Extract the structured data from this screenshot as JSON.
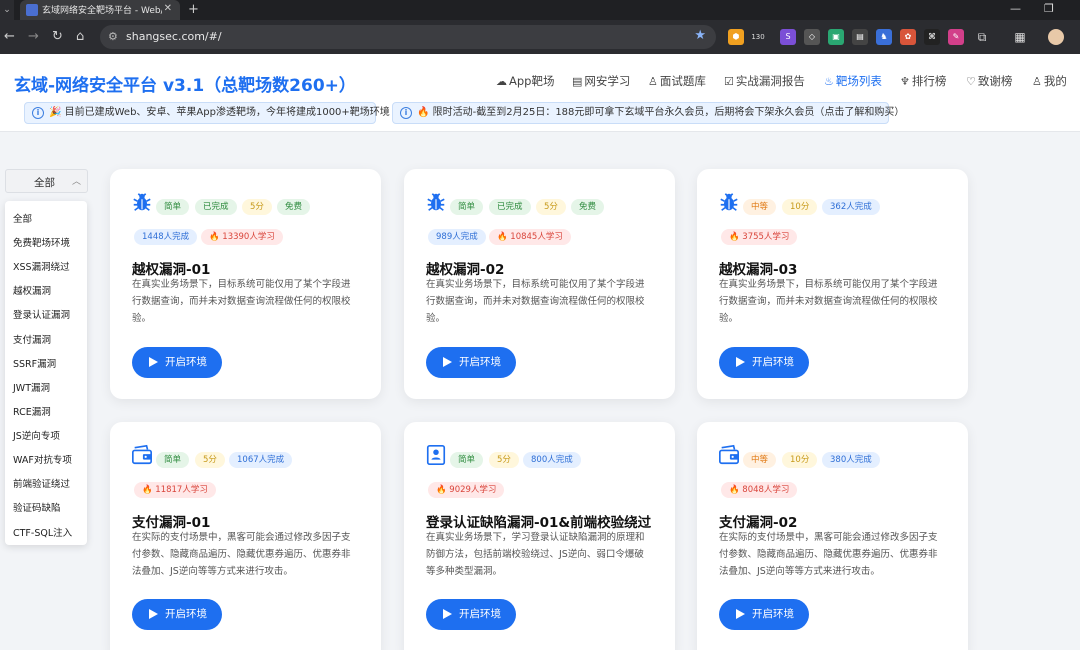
{
  "browser": {
    "tab_title": "玄域网络安全靶场平台 - Web/App",
    "url": "shangsec.com/#/",
    "ext_badge": "130"
  },
  "site": {
    "title": "玄域-网络安全平台 v3.1（总靶场数260+）",
    "nav": [
      {
        "label": "App靶场",
        "icon": "☁"
      },
      {
        "label": "网安学习",
        "icon": "▤"
      },
      {
        "label": "面试题库",
        "icon": "♙"
      },
      {
        "label": "实战漏洞报告",
        "icon": "☑"
      },
      {
        "label": "靶场列表",
        "icon": "♨"
      },
      {
        "label": "排行榜",
        "icon": "♆"
      },
      {
        "label": "致谢榜",
        "icon": "♡"
      },
      {
        "label": "我的",
        "icon": "♙"
      }
    ],
    "notice1": "🎉 目前已建成Web、安卓、苹果App渗透靶场，今年将建成1000+靶场环境",
    "notice2": "🔥 限时活动-截至到2月25日：188元即可拿下玄域平台永久会员，后期将会下架永久会员（点击了解和购买）"
  },
  "filter": {
    "selected": "全部",
    "options": [
      "全部",
      "免费靶场环境",
      "XSS漏洞绕过",
      "越权漏洞",
      "登录认证漏洞",
      "支付漏洞",
      "SSRF漏洞",
      "JWT漏洞",
      "RCE漏洞",
      "JS逆向专项",
      "WAF对抗专项",
      "前端验证绕过",
      "验证码缺陷",
      "CTF-SQL注入"
    ]
  },
  "cards": [
    {
      "title": "越权漏洞-01",
      "difficulty": "简单",
      "status": "已完成",
      "score": "5分",
      "free": "免费",
      "completed": "1448人完成",
      "learning": "13390人学习",
      "desc": "在真实业务场景下，目标系统可能仅用了某个字段进行数据查询，而并未对数据查询流程做任何的权限校验。"
    },
    {
      "title": "越权漏洞-02",
      "difficulty": "简单",
      "status": "已完成",
      "score": "5分",
      "free": "免费",
      "completed": "989人完成",
      "learning": "10845人学习",
      "desc": "在真实业务场景下，目标系统可能仅用了某个字段进行数据查询，而并未对数据查询流程做任何的权限校验。"
    },
    {
      "title": "越权漏洞-03",
      "difficulty": "中等",
      "score": "10分",
      "completed": "362人完成",
      "learning": "3755人学习",
      "desc": "在真实业务场景下，目标系统可能仅用了某个字段进行数据查询，而并未对数据查询流程做任何的权限校验。"
    },
    {
      "title": "支付漏洞-01",
      "difficulty": "简单",
      "score": "5分",
      "completed": "1067人完成",
      "learning": "11817人学习",
      "desc": "在实际的支付场景中，黑客可能会通过修改多因子支付参数、隐藏商品遍历、隐藏优惠券遍历、优惠券非法叠加、JS逆向等等方式来进行攻击。"
    },
    {
      "title": "登录认证缺陷漏洞-01&前端校验绕过",
      "difficulty": "简单",
      "score": "5分",
      "completed": "800人完成",
      "learning": "9029人学习",
      "desc": "在真实业务场景下，学习登录认证缺陷漏洞的原理和防御方法，包括前端校验绕过、JS逆向、弱口令爆破等多种类型漏洞。"
    },
    {
      "title": "支付漏洞-02",
      "difficulty": "中等",
      "score": "10分",
      "completed": "380人完成",
      "learning": "8048人学习",
      "desc": "在实际的支付场景中，黑客可能会通过修改多因子支付参数、隐藏商品遍历、隐藏优惠券遍历、优惠券非法叠加、JS逆向等等方式来进行攻击。"
    }
  ],
  "start_label": "开启环境",
  "colors": {
    "primary": "#1e6ff0",
    "bg": "#f2f4f7"
  }
}
